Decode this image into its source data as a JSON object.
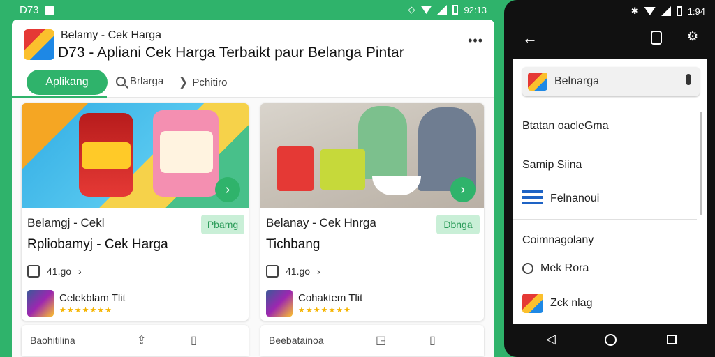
{
  "status_left": {
    "label": "D73",
    "time": "92:13"
  },
  "app": {
    "subtitle": "Belamy - Cek Harga",
    "title": "D73 - Apliani Cek Harga Terbaikt paur Belanga Pintar",
    "more": "•••"
  },
  "tabs": [
    {
      "label": "Aplikang"
    },
    {
      "label": "Brlarga"
    },
    {
      "label": "Pchitiro"
    }
  ],
  "cards": [
    {
      "title": "Belamgj - Cekl",
      "subtitle": "Rpliobamyj - Cek Harga",
      "badge": "Pbamg",
      "meta": "41.go",
      "meta_arrow": "›",
      "store": "Celekblam Tlit",
      "stars": "★★★★★★★",
      "footer": "Baohitilina"
    },
    {
      "title": "Belanay - Cek Hnrga",
      "subtitle": "Tichbang",
      "badge": "Dbnga",
      "meta": "41.go",
      "meta_arrow": "›",
      "store": "Cohaktem Tlit",
      "stars": "★★★★★★★",
      "footer": "Beebatainoa"
    }
  ],
  "phone": {
    "time": "1:94",
    "search": "Belnarga",
    "rows": [
      {
        "label": "Btatan oacleGma"
      },
      {
        "label": "Samip Siina"
      },
      {
        "label": "Felnanoui"
      },
      {
        "label": "Coimnagolany"
      },
      {
        "label": "Mek Rora"
      },
      {
        "label": "Zck nlag"
      }
    ]
  },
  "icons": {
    "go": "›",
    "back": "←",
    "nav_back": "◁"
  },
  "colors": {
    "accent": "#2fb36b",
    "badge_bg": "#c9efd7",
    "stars": "#f5b400"
  }
}
